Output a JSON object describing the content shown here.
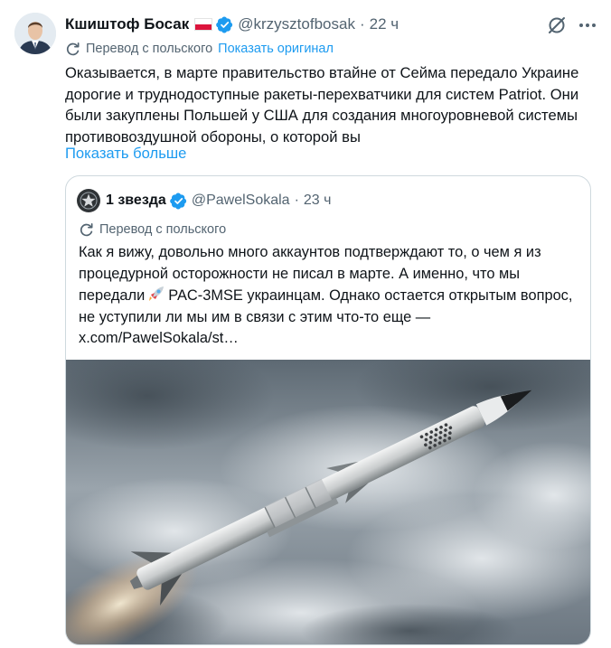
{
  "tweet": {
    "author_name": "Кшиштоф Босак",
    "handle": "@krzysztofbosak",
    "separator": "·",
    "time": "22 ч",
    "translation_label": "Перевод с польского",
    "show_original_label": "Показать оригинал",
    "text": "Оказывается, в марте правительство втайне от Сейма передало Украине дорогие и труднодоступные ракеты-перехватчики для систем Patriot. Они были закуплены Польшей у США для создания многоуровневой системы противовоздушной обороны, о которой вы",
    "show_more_label": "Показать больше",
    "icons": [
      "verified-badge",
      "poland-flag",
      "grok-icon",
      "more-icon",
      "translate-icon"
    ]
  },
  "quote": {
    "author_name": "1 звезда",
    "handle": "@PawelSokala",
    "separator": "·",
    "time": "23 ч",
    "translation_label": "Перевод с польского",
    "text_before_emoji": "Как я вижу, довольно много аккаунтов подтверждают то, о чем я из процедурной осторожности не писал в марте. А именно, что мы передали",
    "text_after_emoji": "PAC-3MSE украинцам. Однако остается открытым вопрос, не уступили ли мы им в связи с этим что-то еще — x.com/PawelSokala/st…",
    "emoji": "rocket-emoji",
    "image": "missile-launch-photo"
  },
  "colors": {
    "text": "#0f1419",
    "secondary": "#536471",
    "link": "#1d9bf0",
    "border": "#cfd9de"
  }
}
